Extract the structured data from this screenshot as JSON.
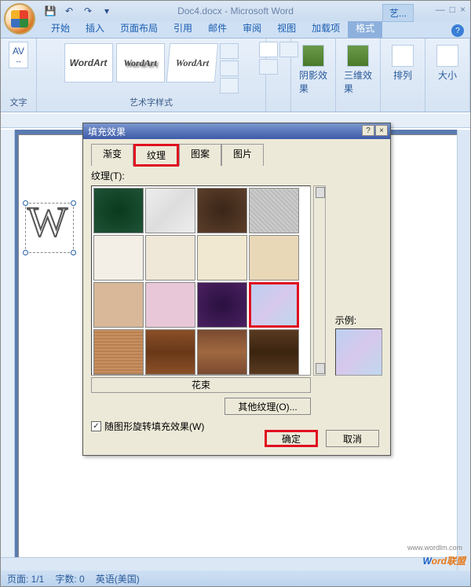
{
  "titlebar": {
    "doc_title": "Doc4.docx - Microsoft Word",
    "tool_tab": "艺..."
  },
  "tabs": {
    "items": [
      "开始",
      "插入",
      "页面布局",
      "引用",
      "邮件",
      "审阅",
      "视图",
      "加载项",
      "格式"
    ],
    "active_index": 8
  },
  "ribbon": {
    "text_group": "文字",
    "av_label": "AV",
    "wordart_samples": [
      "WordArt",
      "WordArt",
      "WordArt"
    ],
    "gallery_label": "艺术字样式",
    "shadow": "阴影效果",
    "threed": "三维效果",
    "arrange": "排列",
    "size": "大小"
  },
  "dialog": {
    "title": "填充效果",
    "tabs": [
      "渐变",
      "纹理",
      "图案",
      "图片"
    ],
    "active_tab_index": 1,
    "texture_label": "纹理(T):",
    "selected_name": "花束",
    "sample_label": "示例:",
    "other_btn": "其他纹理(O)...",
    "rotate_check": "随图形旋转填充效果(W)",
    "rotate_checked": true,
    "ok": "确定",
    "cancel": "取消"
  },
  "statusbar": {
    "page": "页面: 1/1",
    "words": "字数: 0",
    "lang": "英语(美国)"
  },
  "watermark": {
    "text1": "W",
    "text2": "ord联盟",
    "url": "www.wordlm.com"
  }
}
